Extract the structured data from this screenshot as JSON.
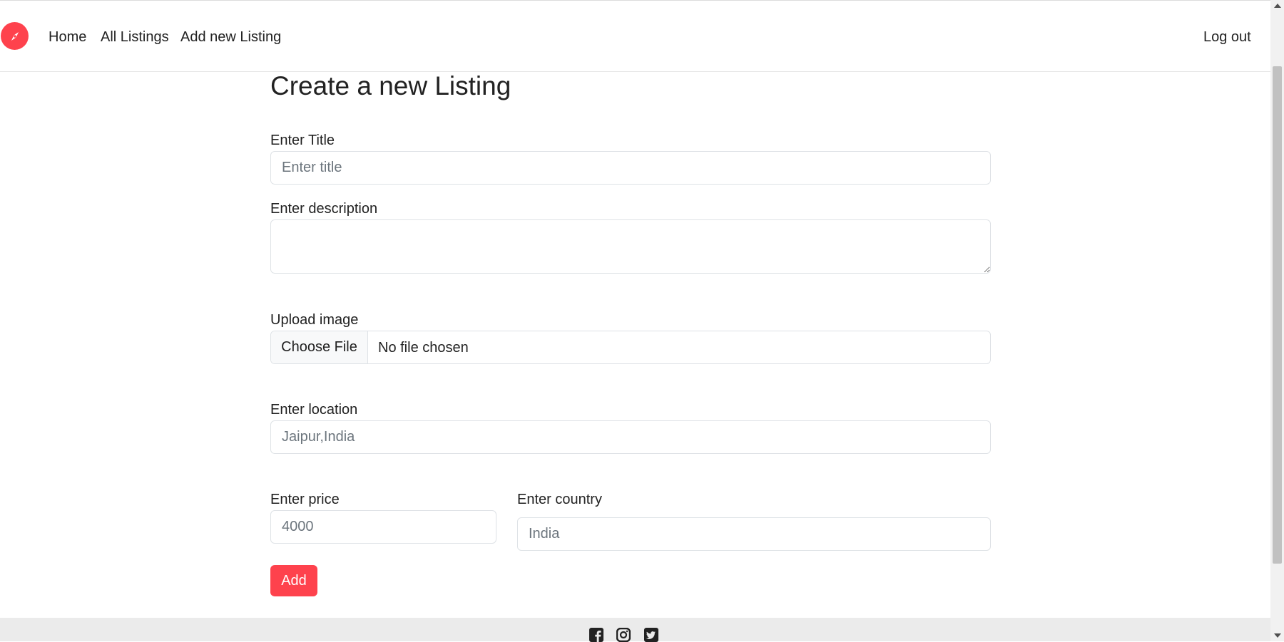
{
  "navbar": {
    "brand_icon": "compass-icon",
    "brand_color": "#fe424d",
    "links": [
      {
        "label": "Home"
      },
      {
        "label": "All Listings"
      },
      {
        "label": "Add new Listing"
      }
    ],
    "logout_label": "Log out"
  },
  "form": {
    "title": "Create a new Listing",
    "title_field": {
      "label": "Enter Title",
      "placeholder": "Enter title",
      "value": ""
    },
    "description_field": {
      "label": "Enter description",
      "value": ""
    },
    "image_field": {
      "label": "Upload image",
      "button_label": "Choose File",
      "status": "No file chosen"
    },
    "location_field": {
      "label": "Enter location",
      "placeholder": "Jaipur,India",
      "value": ""
    },
    "price_field": {
      "label": "Enter price",
      "placeholder": "4000",
      "value": ""
    },
    "country_field": {
      "label": "Enter country",
      "placeholder": "India",
      "value": ""
    },
    "submit_label": "Add",
    "accent_color": "#fe424d"
  },
  "footer": {
    "social_icons": [
      "facebook-icon",
      "instagram-icon",
      "twitter-icon"
    ]
  }
}
